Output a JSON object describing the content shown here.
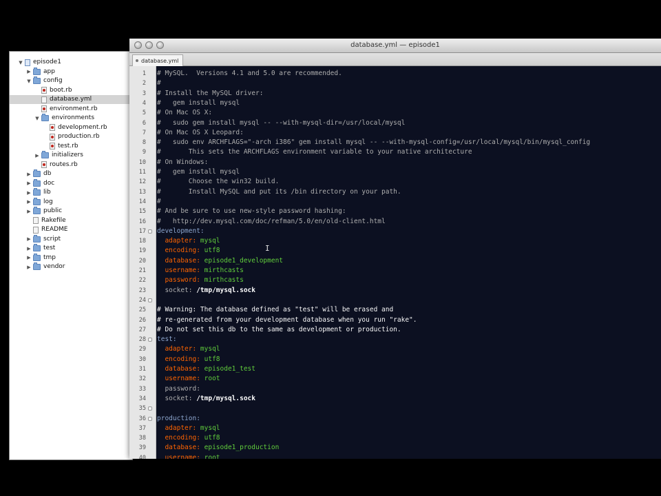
{
  "drawer": {
    "items": [
      {
        "label": "episode1",
        "type": "project",
        "depth": 0,
        "open": true
      },
      {
        "label": "app",
        "type": "folder",
        "depth": 1,
        "open": false
      },
      {
        "label": "config",
        "type": "folder",
        "depth": 1,
        "open": true
      },
      {
        "label": "boot.rb",
        "type": "ruby",
        "depth": 2
      },
      {
        "label": "database.yml",
        "type": "file",
        "depth": 2,
        "selected": true
      },
      {
        "label": "environment.rb",
        "type": "ruby",
        "depth": 2
      },
      {
        "label": "environments",
        "type": "folder",
        "depth": 2,
        "open": true
      },
      {
        "label": "development.rb",
        "type": "ruby",
        "depth": 3
      },
      {
        "label": "production.rb",
        "type": "ruby",
        "depth": 3
      },
      {
        "label": "test.rb",
        "type": "ruby",
        "depth": 3
      },
      {
        "label": "initializers",
        "type": "folder",
        "depth": 2,
        "open": false
      },
      {
        "label": "routes.rb",
        "type": "ruby",
        "depth": 2
      },
      {
        "label": "db",
        "type": "folder",
        "depth": 1,
        "open": false
      },
      {
        "label": "doc",
        "type": "folder",
        "depth": 1,
        "open": false
      },
      {
        "label": "lib",
        "type": "folder",
        "depth": 1,
        "open": false
      },
      {
        "label": "log",
        "type": "folder",
        "depth": 1,
        "open": false
      },
      {
        "label": "public",
        "type": "folder",
        "depth": 1,
        "open": false
      },
      {
        "label": "Rakefile",
        "type": "file",
        "depth": 1
      },
      {
        "label": "README",
        "type": "file",
        "depth": 1
      },
      {
        "label": "script",
        "type": "folder",
        "depth": 1,
        "open": false
      },
      {
        "label": "test",
        "type": "folder",
        "depth": 1,
        "open": false
      },
      {
        "label": "tmp",
        "type": "folder",
        "depth": 1,
        "open": false
      },
      {
        "label": "vendor",
        "type": "folder",
        "depth": 1,
        "open": false
      }
    ]
  },
  "window": {
    "title": "database.yml — episode1",
    "tab_label": "database.yml"
  },
  "editor": {
    "colors": {
      "background": "#0c1021",
      "comment": "#aeaeae",
      "key": "#fbde2d",
      "value": "#61ce3c",
      "section": "#8da6ce"
    },
    "fold_lines": [
      17,
      24,
      28,
      35,
      36
    ],
    "lines": [
      {
        "n": 1,
        "parts": [
          {
            "t": "# MySQL.  Versions 4.1 and 5.0 are recommended.",
            "s": "comment"
          }
        ]
      },
      {
        "n": 2,
        "parts": [
          {
            "t": "#",
            "s": "comment"
          }
        ]
      },
      {
        "n": 3,
        "parts": [
          {
            "t": "# Install the MySQL driver:",
            "s": "comment"
          }
        ]
      },
      {
        "n": 4,
        "parts": [
          {
            "t": "#   gem install mysql",
            "s": "comment"
          }
        ]
      },
      {
        "n": 5,
        "parts": [
          {
            "t": "# On Mac OS X:",
            "s": "comment"
          }
        ]
      },
      {
        "n": 6,
        "parts": [
          {
            "t": "#   sudo gem install mysql -- --with-mysql-dir=/usr/local/mysql",
            "s": "comment"
          }
        ]
      },
      {
        "n": 7,
        "parts": [
          {
            "t": "# On Mac OS X Leopard:",
            "s": "comment"
          }
        ]
      },
      {
        "n": 8,
        "parts": [
          {
            "t": "#   sudo env ARCHFLAGS=\"-arch i386\" gem install mysql -- --with-mysql-config=/usr/local/mysql/bin/mysql_config",
            "s": "comment"
          }
        ]
      },
      {
        "n": 9,
        "parts": [
          {
            "t": "#       This sets the ARCHFLAGS environment variable to your native architecture",
            "s": "comment"
          }
        ]
      },
      {
        "n": 10,
        "parts": [
          {
            "t": "# On Windows:",
            "s": "comment"
          }
        ]
      },
      {
        "n": 11,
        "parts": [
          {
            "t": "#   gem install mysql",
            "s": "comment"
          }
        ]
      },
      {
        "n": 12,
        "parts": [
          {
            "t": "#       Choose the win32 build.",
            "s": "comment"
          }
        ]
      },
      {
        "n": 13,
        "parts": [
          {
            "t": "#       Install MySQL and put its /bin directory on your path.",
            "s": "comment"
          }
        ]
      },
      {
        "n": 14,
        "parts": [
          {
            "t": "#",
            "s": "comment"
          }
        ]
      },
      {
        "n": 15,
        "parts": [
          {
            "t": "# And be sure to use new-style password hashing:",
            "s": "comment"
          }
        ]
      },
      {
        "n": 16,
        "parts": [
          {
            "t": "#   http://dev.mysql.com/doc/refman/5.0/en/old-client.html",
            "s": "comment"
          }
        ]
      },
      {
        "n": 17,
        "parts": [
          {
            "t": "development:",
            "s": "section"
          }
        ]
      },
      {
        "n": 18,
        "parts": [
          {
            "t": "  adapter: ",
            "s": "keyo"
          },
          {
            "t": "mysql",
            "s": "value"
          }
        ]
      },
      {
        "n": 19,
        "parts": [
          {
            "t": "  encoding: ",
            "s": "keyo"
          },
          {
            "t": "utf8",
            "s": "value"
          }
        ]
      },
      {
        "n": 20,
        "parts": [
          {
            "t": "  database: ",
            "s": "keyo"
          },
          {
            "t": "episode1_development",
            "s": "value"
          }
        ]
      },
      {
        "n": 21,
        "parts": [
          {
            "t": "  username: ",
            "s": "keyo"
          },
          {
            "t": "mirthcasts",
            "s": "value"
          }
        ]
      },
      {
        "n": 22,
        "parts": [
          {
            "t": "  password: ",
            "s": "keyo"
          },
          {
            "t": "mirthcasts",
            "s": "value"
          }
        ]
      },
      {
        "n": 23,
        "parts": [
          {
            "t": "  socket: ",
            "s": "comment"
          },
          {
            "t": "/tmp/mysql.sock",
            "s": "bold"
          }
        ]
      },
      {
        "n": 24,
        "parts": [
          {
            "t": "",
            "s": "plain"
          }
        ]
      },
      {
        "n": 25,
        "parts": [
          {
            "t": "# Warning: The database defined as \"test\" will be erased and",
            "s": "plain"
          }
        ]
      },
      {
        "n": 26,
        "parts": [
          {
            "t": "# re-generated from your development database when you run \"rake\".",
            "s": "plain"
          }
        ]
      },
      {
        "n": 27,
        "parts": [
          {
            "t": "# Do not set this db to the same as development or production.",
            "s": "plain"
          }
        ]
      },
      {
        "n": 28,
        "parts": [
          {
            "t": "test:",
            "s": "section"
          }
        ]
      },
      {
        "n": 29,
        "parts": [
          {
            "t": "  adapter: ",
            "s": "keyo"
          },
          {
            "t": "mysql",
            "s": "value"
          }
        ]
      },
      {
        "n": 30,
        "parts": [
          {
            "t": "  encoding: ",
            "s": "keyo"
          },
          {
            "t": "utf8",
            "s": "value"
          }
        ]
      },
      {
        "n": 31,
        "parts": [
          {
            "t": "  database: ",
            "s": "keyo"
          },
          {
            "t": "episode1_test",
            "s": "value"
          }
        ]
      },
      {
        "n": 32,
        "parts": [
          {
            "t": "  username: ",
            "s": "keyo"
          },
          {
            "t": "root",
            "s": "value"
          }
        ]
      },
      {
        "n": 33,
        "parts": [
          {
            "t": "  password:",
            "s": "comment"
          }
        ]
      },
      {
        "n": 34,
        "parts": [
          {
            "t": "  socket: ",
            "s": "comment"
          },
          {
            "t": "/tmp/mysql.sock",
            "s": "bold"
          }
        ]
      },
      {
        "n": 35,
        "parts": [
          {
            "t": "",
            "s": "plain"
          }
        ]
      },
      {
        "n": 36,
        "parts": [
          {
            "t": "production:",
            "s": "section"
          }
        ]
      },
      {
        "n": 37,
        "parts": [
          {
            "t": "  adapter: ",
            "s": "keyo"
          },
          {
            "t": "mysql",
            "s": "value"
          }
        ]
      },
      {
        "n": 38,
        "parts": [
          {
            "t": "  encoding: ",
            "s": "keyo"
          },
          {
            "t": "utf8",
            "s": "value"
          }
        ]
      },
      {
        "n": 39,
        "parts": [
          {
            "t": "  database: ",
            "s": "keyo"
          },
          {
            "t": "episode1_production",
            "s": "value"
          }
        ]
      },
      {
        "n": 40,
        "parts": [
          {
            "t": "  username: ",
            "s": "keyo"
          },
          {
            "t": "root",
            "s": "value"
          }
        ]
      }
    ]
  }
}
